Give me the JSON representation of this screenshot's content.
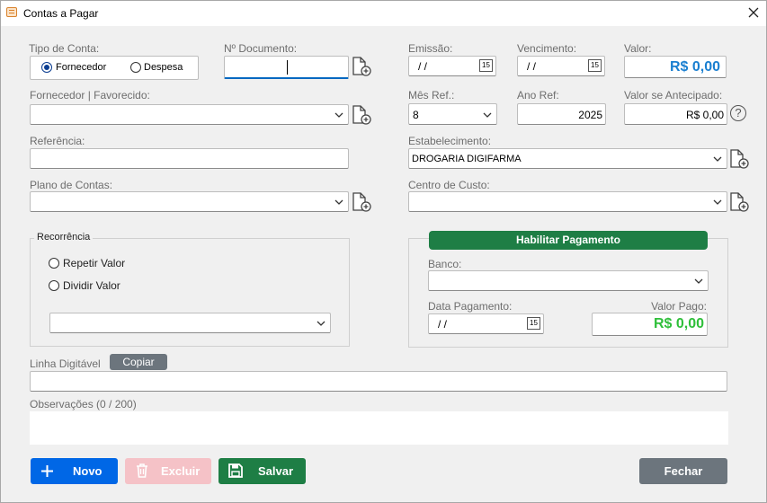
{
  "window": {
    "title": "Contas a Pagar"
  },
  "tipo_conta": {
    "label": "Tipo de Conta:",
    "option_fornecedor": "Fornecedor",
    "option_despesa": "Despesa",
    "selected": "Fornecedor"
  },
  "documento": {
    "label": "Nº Documento:",
    "value": ""
  },
  "emissao": {
    "label": "Emissão:",
    "value": "/  /",
    "cal_glyph": "15"
  },
  "vencimento": {
    "label": "Vencimento:",
    "value": "/  /",
    "cal_glyph": "15"
  },
  "valor": {
    "label": "Valor:",
    "value": "R$ 0,00"
  },
  "fornecedor": {
    "label": "Fornecedor  |  Favorecido:",
    "value": ""
  },
  "mes_ref": {
    "label": "Mês Ref.:",
    "value": "8"
  },
  "ano_ref": {
    "label": "Ano Ref:",
    "value": "2025"
  },
  "valor_antecipado": {
    "label": "Valor se Antecipado:",
    "value": "R$ 0,00",
    "help_glyph": "?"
  },
  "referencia": {
    "label": "Referência:",
    "value": ""
  },
  "estabelecimento": {
    "label": "Estabelecimento:",
    "value": "DROGARIA DIGIFARMA"
  },
  "plano_contas": {
    "label": "Plano de Contas:",
    "value": ""
  },
  "centro_custo": {
    "label": "Centro de Custo:",
    "value": ""
  },
  "recorrencia": {
    "legend": "Recorrência",
    "opt_repetir": "Repetir Valor",
    "opt_dividir": "Dividir Valor",
    "select_value": ""
  },
  "pagamento": {
    "enable_button": "Habilitar Pagamento",
    "banco_label": "Banco:",
    "banco_value": "",
    "data_label": "Data Pagamento:",
    "data_value": "/  /",
    "cal_glyph": "15",
    "valor_pago_label": "Valor Pago:",
    "valor_pago_value": "R$ 0,00"
  },
  "linha_digitavel": {
    "label": "Linha Digitável",
    "copy_button": "Copiar",
    "value": ""
  },
  "observacoes": {
    "label": "Observações (0 / 200)",
    "value": ""
  },
  "buttons": {
    "novo": "Novo",
    "excluir": "Excluir",
    "salvar": "Salvar",
    "fechar": "Fechar"
  },
  "colors": {
    "primary_blue": "#0067e6",
    "green": "#1e7e45",
    "delete_disabled": "#f5c2c7",
    "close_gray": "#6c757d",
    "valor_blue": "#1a7fd0",
    "valor_pago_green": "#2fbf3a"
  }
}
